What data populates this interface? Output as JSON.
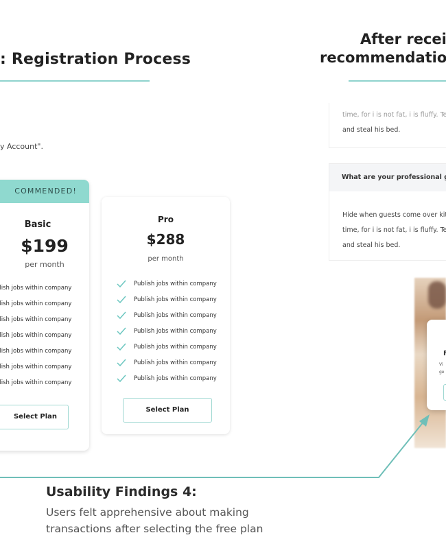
{
  "left_section": {
    "title": ": Registration Process",
    "note_text": "y Account\"."
  },
  "right_section": {
    "title_line1": "After recei",
    "title_line2": "recommendatio"
  },
  "basic_plan": {
    "banner": "COMMENDED!",
    "name": "Basic",
    "price": "$199",
    "period": "per month",
    "features": [
      "blish jobs within company",
      "blish jobs within company",
      "blish jobs within company",
      "blish jobs within company",
      "blish jobs within company",
      "blish jobs within company",
      "blish jobs within company"
    ],
    "button_label": "Select Plan"
  },
  "pro_plan": {
    "name": "Pro",
    "price": "$288",
    "period": "per month",
    "features": [
      "Publish jobs within company",
      "Publish jobs within company",
      "Publish jobs within company",
      "Publish jobs within company",
      "Publish jobs within company",
      "Publish jobs within company",
      "Publish jobs within company"
    ],
    "button_label": "Select Plan"
  },
  "answer_card_top": {
    "line1": "time, for i is not fat, i is fluffy. Terr",
    "line2": "and steal his bed."
  },
  "qa_card": {
    "question": "What are your professional goal",
    "line1": "Hide when guests come over kitt",
    "line2": "time, for i is not fat, i is fluffy. Terre",
    "line3": "and steal his bed."
  },
  "modal": {
    "title": "F",
    "line1": "Vi",
    "line2": "ge"
  },
  "findings": {
    "title": "Usability Findings 4:",
    "line1": "Users felt apprehensive about making",
    "line2": "transactions after selecting the free plan"
  },
  "colors": {
    "accent": "#8fd3cd",
    "check": "#6cc7c0",
    "arrow": "#6fbfb8"
  }
}
